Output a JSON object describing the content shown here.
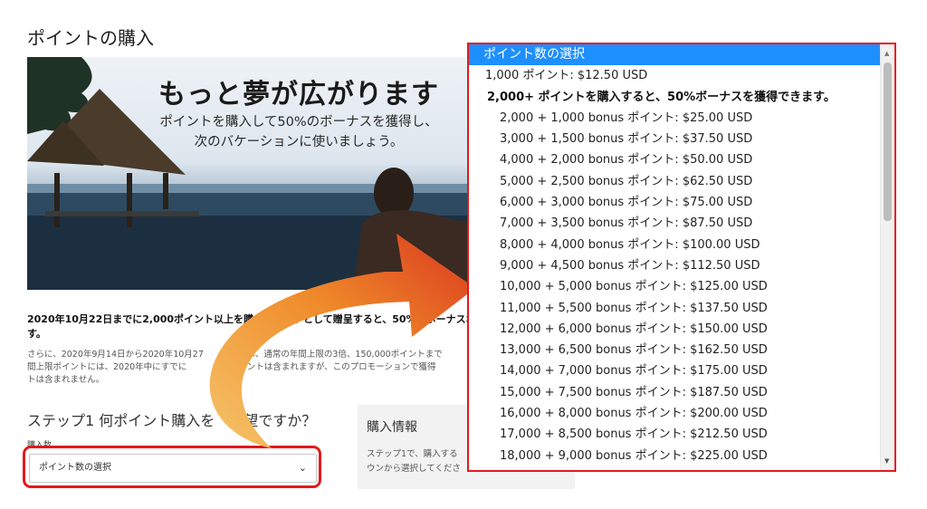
{
  "page": {
    "title": "ポイントの購入"
  },
  "hero": {
    "headline": "もっと夢が広がります",
    "subtitle_line1": "ポイントを購入して50%のボーナスを獲得し、",
    "subtitle_line2": "次のバケーションに使いましょう。"
  },
  "promo": {
    "bold_line1": "2020年10月22日までに2,000ポイント以上を購　　ギフトとして贈呈すると、50%のボーナスポ",
    "bold_line2": "す。",
    "small_line1": "さらに、2020年9月14日から2020年10月27　　の期間は、通常の年間上限の3倍、150,000ポイントまで",
    "small_line2": "間上限ポイントには、2020年中にすでに　　　れたポイントは含まれますが、このプロモーションで獲得",
    "small_line3": "トは含まれません。"
  },
  "step1": {
    "heading": "ステップ1 何ポイント購入を　　望ですか？",
    "quantity_label": "購入数",
    "select_value": "ポイント数の選択"
  },
  "info": {
    "title": "購入情報",
    "text_line1": "ステップ1で、購入する",
    "text_line2": "ウンから選択してくださ"
  },
  "dropdown": {
    "selected": "ポイント数の選択",
    "basic_option": "1,000 ポイント: $12.50 USD",
    "group_label": "2,000+ ポイントを購入すると、50%ボーナスを獲得できます。",
    "options": [
      "2,000 + 1,000 bonus ポイント: $25.00 USD",
      "3,000 + 1,500 bonus ポイント: $37.50 USD",
      "4,000 + 2,000 bonus ポイント: $50.00 USD",
      "5,000 + 2,500 bonus ポイント: $62.50 USD",
      "6,000 + 3,000 bonus ポイント: $75.00 USD",
      "7,000 + 3,500 bonus ポイント: $87.50 USD",
      "8,000 + 4,000 bonus ポイント: $100.00 USD",
      "9,000 + 4,500 bonus ポイント: $112.50 USD",
      "10,000 + 5,000 bonus ポイント: $125.00 USD",
      "11,000 + 5,500 bonus ポイント: $137.50 USD",
      "12,000 + 6,000 bonus ポイント: $150.00 USD",
      "13,000 + 6,500 bonus ポイント: $162.50 USD",
      "14,000 + 7,000 bonus ポイント: $175.00 USD",
      "15,000 + 7,500 bonus ポイント: $187.50 USD",
      "16,000 + 8,000 bonus ポイント: $200.00 USD",
      "17,000 + 8,500 bonus ポイント: $212.50 USD",
      "18,000 + 9,000 bonus ポイント: $225.00 USD"
    ]
  },
  "colors": {
    "highlight_red": "#e3191c",
    "selected_blue": "#1e8fff",
    "arrow_orange": "#e8781e"
  },
  "icons": {
    "select_chevron": "chevron-down-icon",
    "scroll_up": "scroll-up-icon",
    "scroll_down": "scroll-down-icon",
    "arrow": "curved-arrow-icon"
  }
}
